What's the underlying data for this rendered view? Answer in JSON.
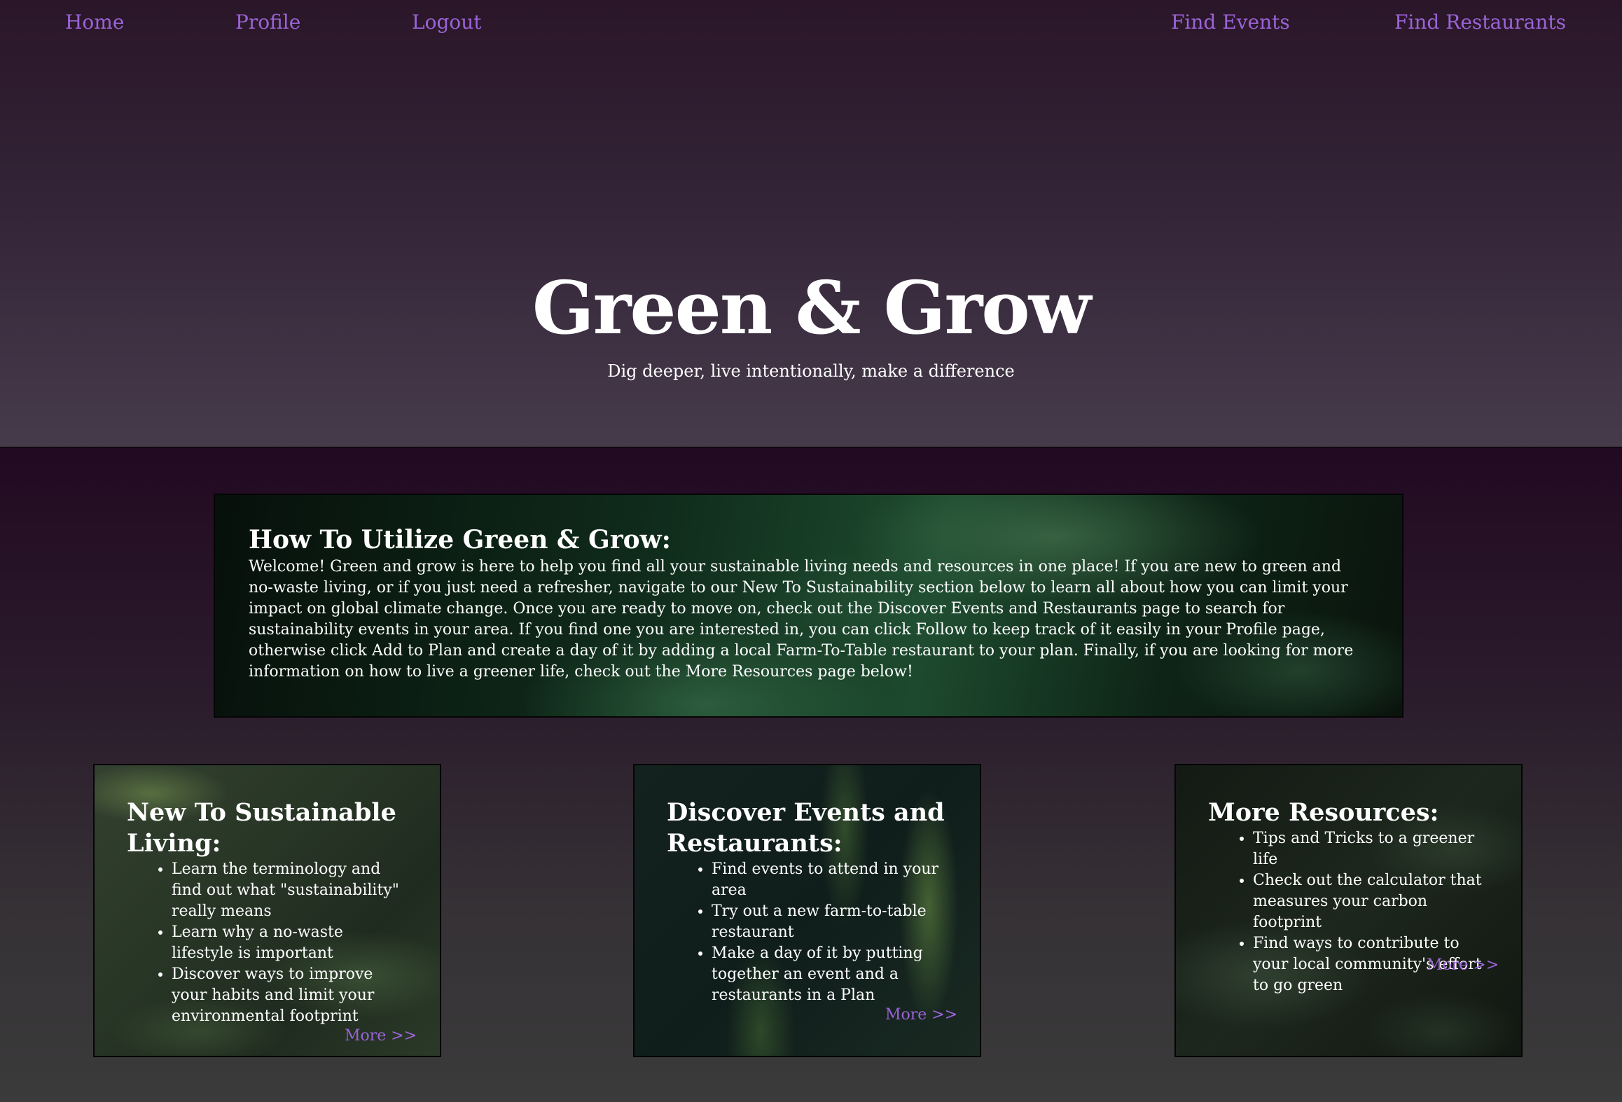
{
  "nav": {
    "home": "Home",
    "profile": "Profile",
    "logout": "Logout",
    "find_events": "Find Events",
    "find_restaurants": "Find Restaurants"
  },
  "hero": {
    "title": "Green & Grow",
    "subtitle": "Dig deeper, live intentionally, make a difference"
  },
  "intro": {
    "heading": "How To Utilize Green & Grow:",
    "body": "Welcome! Green and grow is here to help you find all your sustainable living needs and resources in one place! If you are new to green and no-waste living, or if you just need a refresher, navigate to our New To Sustainability section below to learn all about how you can limit your impact on global climate change. Once you are ready to move on, check out the Discover Events and Restaurants page to search for sustainability events in your area. If you find one you are interested in, you can click Follow to keep track of it easily in your Profile page, otherwise click Add to Plan and create a day of it by adding a local Farm-To-Table restaurant to your plan. Finally, if you are looking for more information on how to live a greener life, check out the More Resources page below!"
  },
  "cards": [
    {
      "heading": "New To Sustainable Living:",
      "items": [
        "Learn the terminology and find out what \"sustainability\" really means",
        "Learn why a no-waste lifestyle is important",
        "Discover ways to improve your habits and limit your environmental footprint"
      ],
      "more": "More >>"
    },
    {
      "heading": "Discover Events and Restaurants:",
      "items": [
        "Find events to attend in your area",
        "Try out a new farm-to-table restaurant",
        "Make a day of it by putting together an event and a restaurants in a Plan"
      ],
      "more": "More >>"
    },
    {
      "heading": "More Resources:",
      "items": [
        "Tips and Tricks to a greener life",
        "Check out the calculator that measures your carbon footprint",
        "Find ways to contribute to your local community's effort to go green"
      ],
      "more": "More >>"
    }
  ],
  "colors": {
    "link": "#9b63d8",
    "text": "#ffffff"
  }
}
